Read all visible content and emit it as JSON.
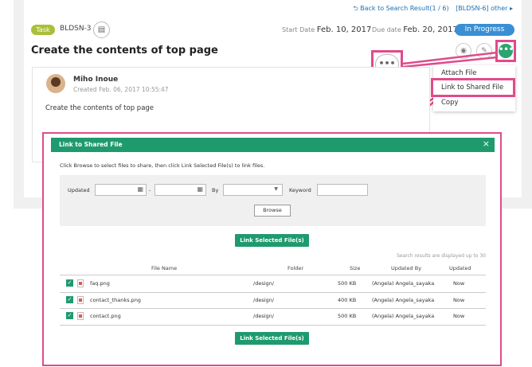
{
  "topnav": {
    "back_label": "Back to Search Result(1 / 6)",
    "other_label": "[BLDSN-6] other ▸"
  },
  "task": {
    "badge": "Task",
    "key": "BLDSN-3",
    "start_label": "Start Date",
    "start_value": "Feb. 10, 2017",
    "due_label": "Due date",
    "due_value": "Feb. 20, 2017",
    "status": "In Progress",
    "title": "Create the contents of top page"
  },
  "comment": {
    "author": "Miho Inoue",
    "created": "Created  Feb. 06, 2017 10:55:47",
    "text": "Create the contents of top page"
  },
  "more_menu": {
    "items": [
      "Attach File",
      "Link to Shared File",
      "Copy"
    ]
  },
  "dialog": {
    "title": "Link to Shared File",
    "close": "×",
    "instruction": "Click Browse to select files to share, then click Link Selected File(s) to link files.",
    "filter": {
      "updated_label": "Updated",
      "dash": "-",
      "by_label": "By",
      "keyword_label": "Keyword",
      "browse_label": "Browse"
    },
    "link_button_label": "Link Selected File(s)",
    "search_note": "Search results are displayed up to 30",
    "columns": [
      "File Name",
      "Folder",
      "Size",
      "Updated By",
      "Updated"
    ],
    "rows": [
      {
        "name": "faq.png",
        "folder": "/design/",
        "size": "500 KB",
        "updated_by": "(Angela) Angela_sayaka",
        "updated": "Now"
      },
      {
        "name": "contact_thanks.png",
        "folder": "/design/",
        "size": "400 KB",
        "updated_by": "(Angela) Angela_sayaka",
        "updated": "Now"
      },
      {
        "name": "contact.png",
        "folder": "/design/",
        "size": "500 KB",
        "updated_by": "(Angela) Angela_sayaka",
        "updated": "Now"
      }
    ]
  },
  "colors": {
    "accent_green": "#1f9a6e",
    "highlight_pink": "#e04b8a",
    "status_blue": "#3a8fd4",
    "task_badge": "#a8c03a",
    "due_red": "#e0574d"
  },
  "icons": [
    "clipboard-icon",
    "watch-icon",
    "edit-icon",
    "more-icon",
    "calendar-icon",
    "dropdown-icon",
    "checkbox-icon",
    "image-file-icon",
    "close-icon"
  ]
}
